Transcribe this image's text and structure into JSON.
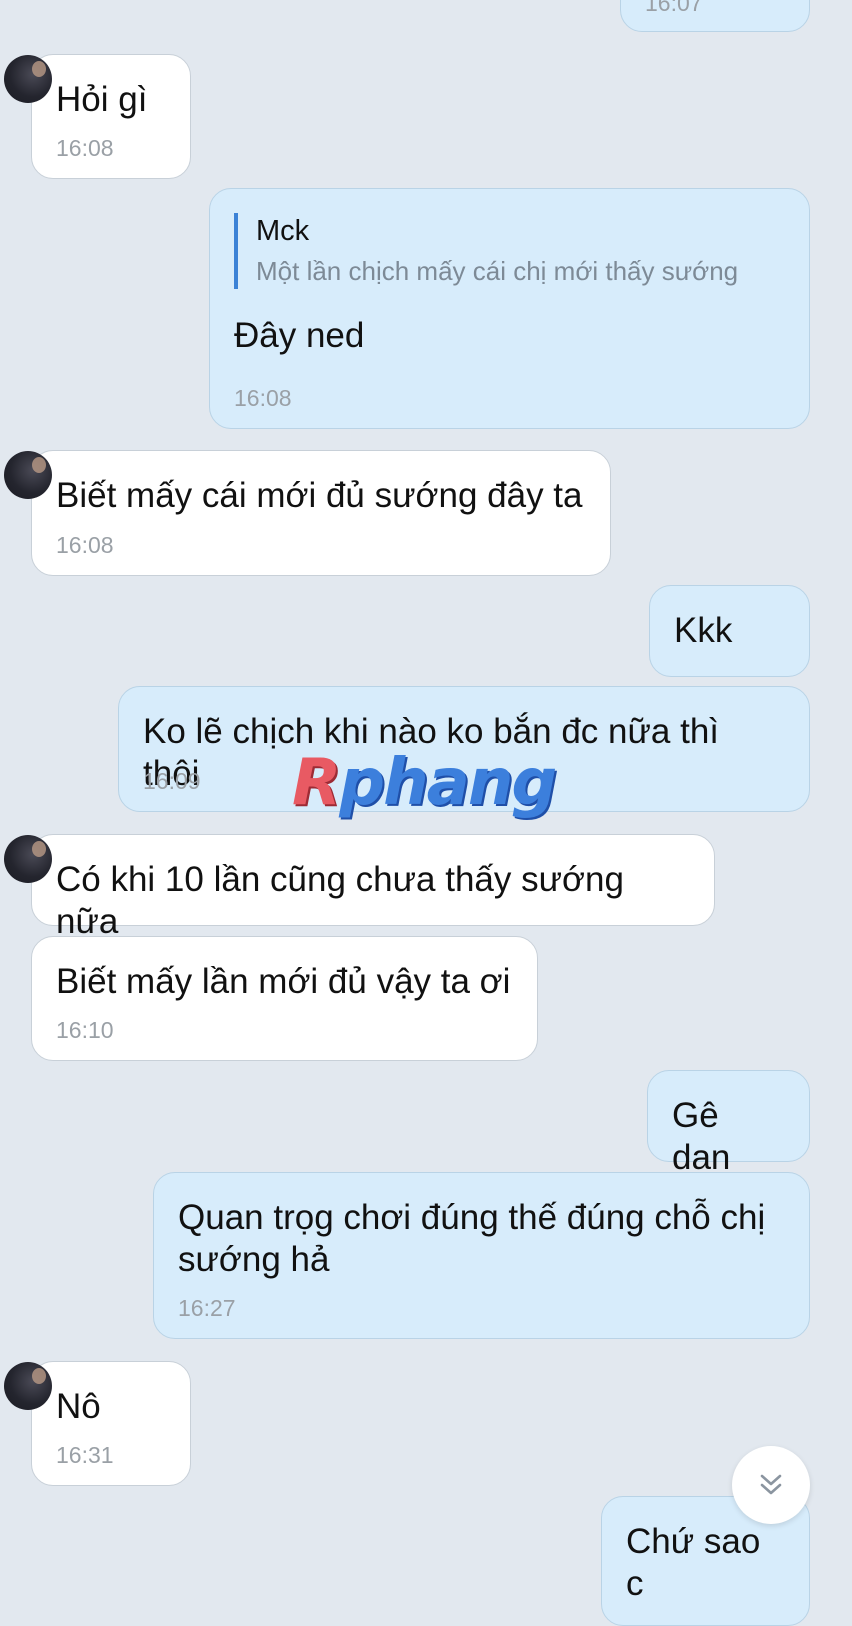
{
  "messages": [
    {
      "text": "",
      "time": "16:07"
    },
    {
      "text": "Hỏi gì",
      "time": "16:08"
    },
    {
      "quote_author": "Mck",
      "quote_text": "Một lần chịch mấy cái chị mới thấy sướng",
      "text": "Đây ned",
      "time": "16:08"
    },
    {
      "text": "Biết mấy cái mới đủ sướng đây ta",
      "time": "16:08"
    },
    {
      "text": "Kkk"
    },
    {
      "text": "Ko lẽ chịch khi nào ko bắn đc nữa thì thôi",
      "time": "16:09"
    },
    {
      "text": "Có khi 10 lần cũng chưa thấy sướng nữa"
    },
    {
      "text": "Biết mấy lần mới đủ vậy ta ơi",
      "time": "16:10"
    },
    {
      "text": "Gê dan"
    },
    {
      "text": "Quan trọg chơi đúng thế đúng chỗ chị\nsướng hả",
      "time": "16:27"
    },
    {
      "text": "Nô",
      "time": "16:31"
    },
    {
      "text": "Chứ sao c"
    }
  ],
  "watermark": {
    "first": "R",
    "rest": "phang"
  },
  "scroll_button": {
    "icon": "double-chevron-down-icon"
  },
  "colors": {
    "background": "#e2e8ef",
    "incoming_bubble": "#ffffff",
    "outgoing_bubble": "#d7ecfb",
    "quote_bar": "#3b82d6",
    "timestamp": "#9aa0a6"
  }
}
